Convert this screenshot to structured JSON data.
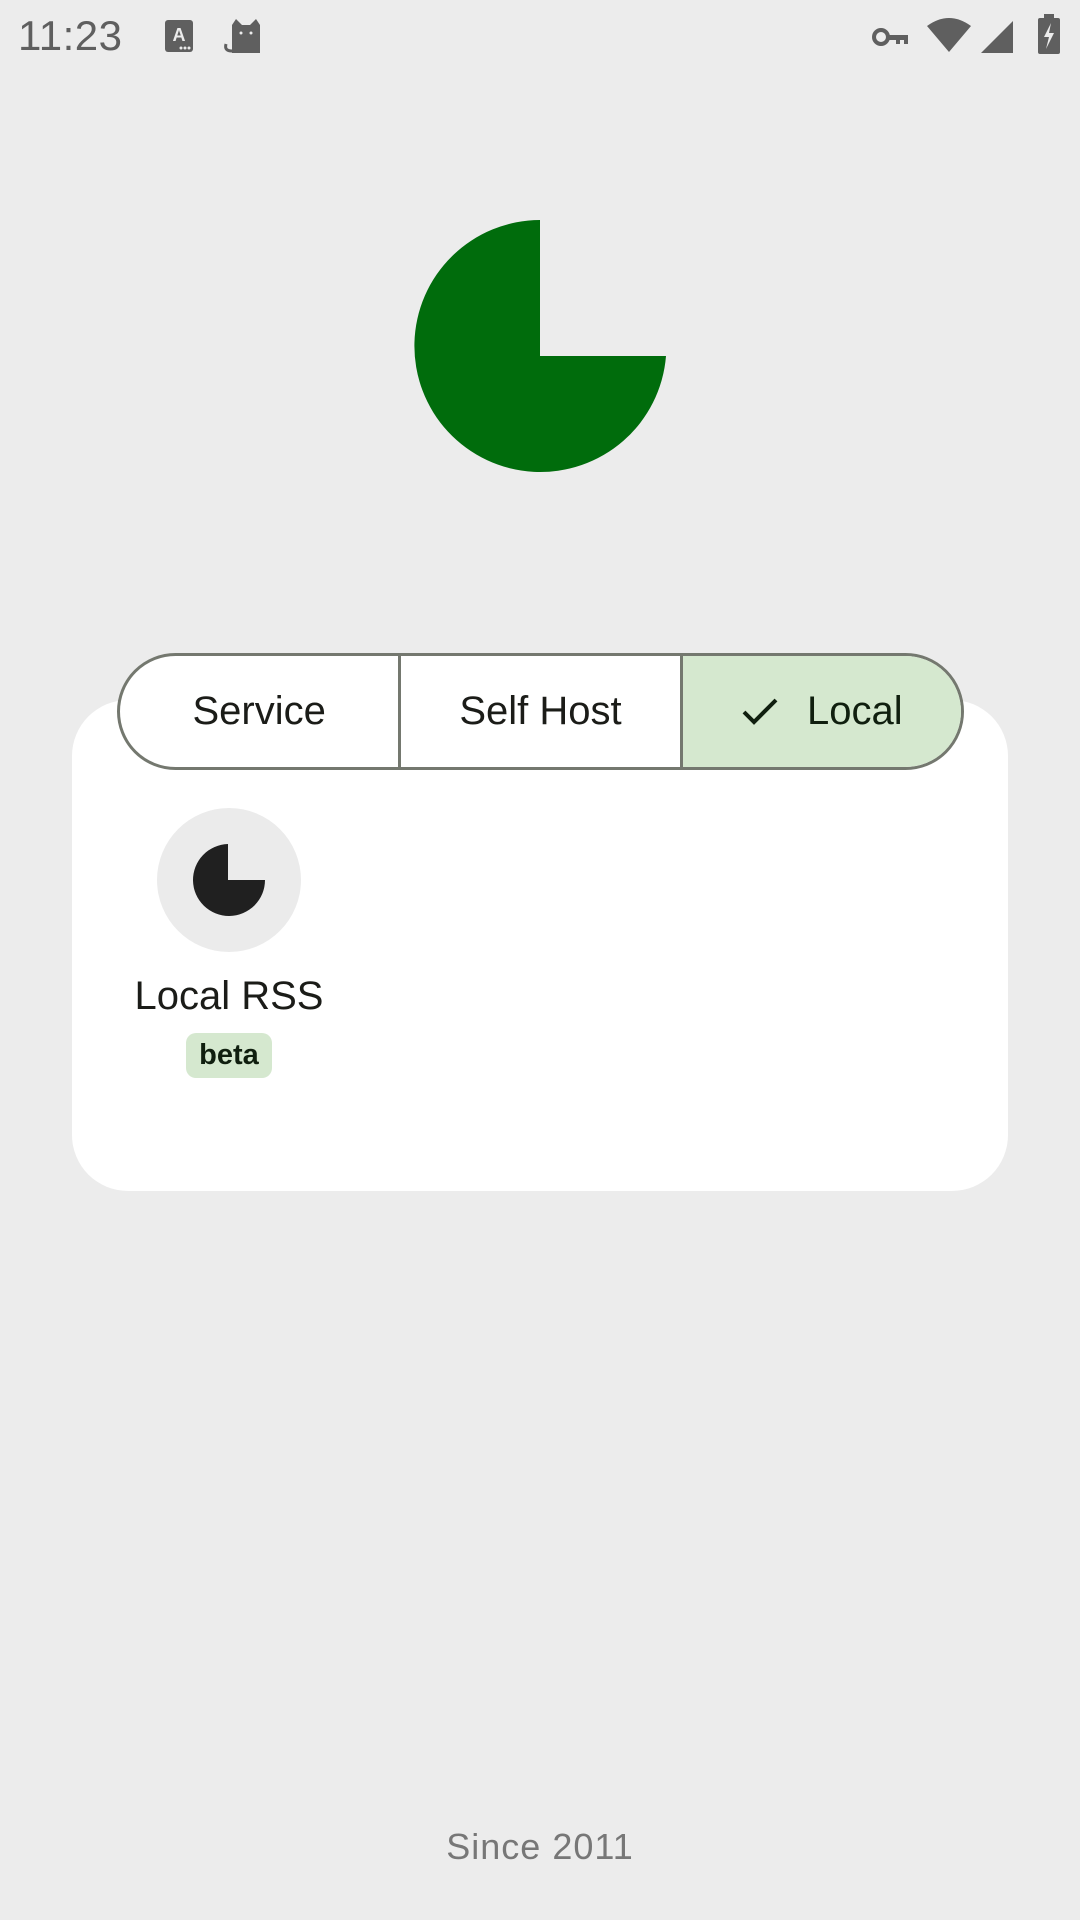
{
  "status_bar": {
    "time": "11:23",
    "left_icons": [
      "keyboard-a-icon",
      "cat-icon"
    ],
    "right_icons": [
      "vpn-key-icon",
      "wifi-icon",
      "signal-icon",
      "battery-charging-icon"
    ]
  },
  "logo": {
    "icon": "pie-logo-icon",
    "color": "#006c0c"
  },
  "segmented": {
    "options": [
      {
        "label": "Service",
        "selected": false
      },
      {
        "label": "Self Host",
        "selected": false
      },
      {
        "label": "Local",
        "selected": true
      }
    ],
    "selected_color": "#d5e8cf",
    "border_color": "#74786f"
  },
  "sources": [
    {
      "label": "Local RSS",
      "badge": "beta",
      "icon": "pie-icon"
    }
  ],
  "footer": {
    "text": "Since 2011"
  }
}
